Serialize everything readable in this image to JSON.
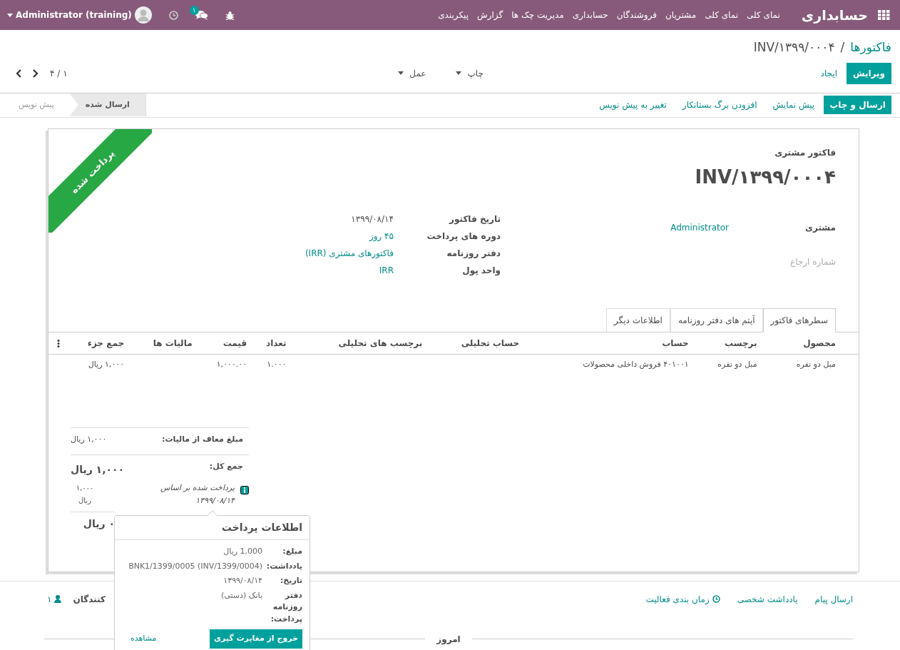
{
  "navbar": {
    "brand": "حسابداری",
    "menu": [
      "نمای کلی",
      "نمای کلی",
      "مشتریان",
      "فروشندگان",
      "حسابداری",
      "مدیریت چک ها",
      "گزارش",
      "پیکربندی"
    ],
    "messages_badge": "۱",
    "user": "Administrator (training)"
  },
  "breadcrumb": {
    "items": [
      {
        "label": "فاکتورها",
        "current": false
      },
      {
        "label": "INV/۱۳۹۹/۰۰۰۴",
        "current": true
      }
    ],
    "separator": "/"
  },
  "control_buttons": [
    {
      "label": "ویرایش",
      "kind": "primary"
    },
    {
      "label": "ایجاد",
      "kind": "link"
    }
  ],
  "dropdowns": [
    "چاپ",
    "عمل"
  ],
  "pager": "۱ / ۴",
  "action_buttons": [
    {
      "label": "ارسال و چاپ",
      "kind": "primary"
    },
    {
      "label": "پیش نمایش",
      "kind": "link"
    },
    {
      "label": "افزودن برگ بستانکار",
      "kind": "link"
    },
    {
      "label": "تغییر به پیش نویس",
      "kind": "link"
    }
  ],
  "stages": [
    {
      "label": "ارسال شده",
      "selected": true
    },
    {
      "label": "پیش نویس",
      "selected": false
    }
  ],
  "sheet": {
    "ribbon": "پرداخت شده",
    "type_label": "فاکتور مشتری",
    "number": "INV/۱۳۹۹/۰۰۰۴",
    "fields_right": [
      {
        "label": "مشتری",
        "value": "Administrator",
        "link": true
      },
      {
        "label": "شماره ارجاع",
        "empty": true
      }
    ],
    "fields_left": [
      {
        "label": "تاریخ فاکتور",
        "value": "۱۳۹۹/۰۸/۱۴",
        "link": false
      },
      {
        "label": "دوره های پرداخت",
        "value": "۴۵ روز",
        "link": true
      },
      {
        "label": "دفتر روزنامه",
        "value": "فاکتورهای مشتری (IRR)",
        "link": true
      },
      {
        "label": "واحد پول",
        "value": "IRR",
        "link": true
      }
    ]
  },
  "tabs": [
    {
      "label": "سطرهای فاکتور",
      "selected": true
    },
    {
      "label": "آیتم های دفتر روزنامه",
      "selected": false
    },
    {
      "label": "اطلاعات دیگر",
      "selected": false
    }
  ],
  "table": {
    "columns": [
      "محصول",
      "برچسب",
      "حساب",
      "حساب تحلیلی",
      "برچسب های تحلیلی",
      "تعداد",
      "قیمت",
      "مالیات ها",
      "جمع جزء"
    ],
    "rows": [
      {
        "cells": [
          "مبل دو نفره",
          "مبل دو نفره",
          "۴۰۱۰۰۱ فروش داخلی محصولات",
          null,
          null,
          "۱.۰۰۰",
          "۱,۰۰۰.۰۰",
          null,
          "۱,۰۰۰ ریال"
        ]
      }
    ]
  },
  "totals": {
    "untaxed": {
      "label": "مبلغ معاف از مالیات:",
      "value": "۱,۰۰۰ ریال"
    },
    "total": {
      "label": "جمع کل:",
      "value": "۱,۰۰۰ ریال"
    },
    "payment": {
      "text": "پرداخت شده بر اساس ۱۳۹۹/۰۸/۱۴",
      "amount": "۱,۰۰۰ ریال"
    },
    "residual_value": "۰ ریال"
  },
  "popover": {
    "title": "اطلاعات پرداخت",
    "rows": [
      {
        "label": "مبلغ:",
        "value": "1,000 ریال"
      },
      {
        "label": "یادداشت:",
        "value": "BNK1/1399/0005 (INV/1399/0004)"
      },
      {
        "label": "تاریخ:",
        "value": "۱۳۹۹/۰۸/۱۴"
      },
      {
        "label": "دفتر روزنامه پرداخت:",
        "value": "بانک (دستی)"
      }
    ],
    "unreconcile": "خروج از مغایرت گیری",
    "open": "مشاهده"
  },
  "chatter": {
    "actions": [
      {
        "label": "ارسال پیام",
        "icon": false
      },
      {
        "label": "یادداشت شخصی",
        "icon": false
      },
      {
        "label": "زمان بندی فعالیت",
        "icon": true
      }
    ],
    "followers_label": "کنندگان",
    "followers_count": "۱",
    "divider": "امروز"
  }
}
